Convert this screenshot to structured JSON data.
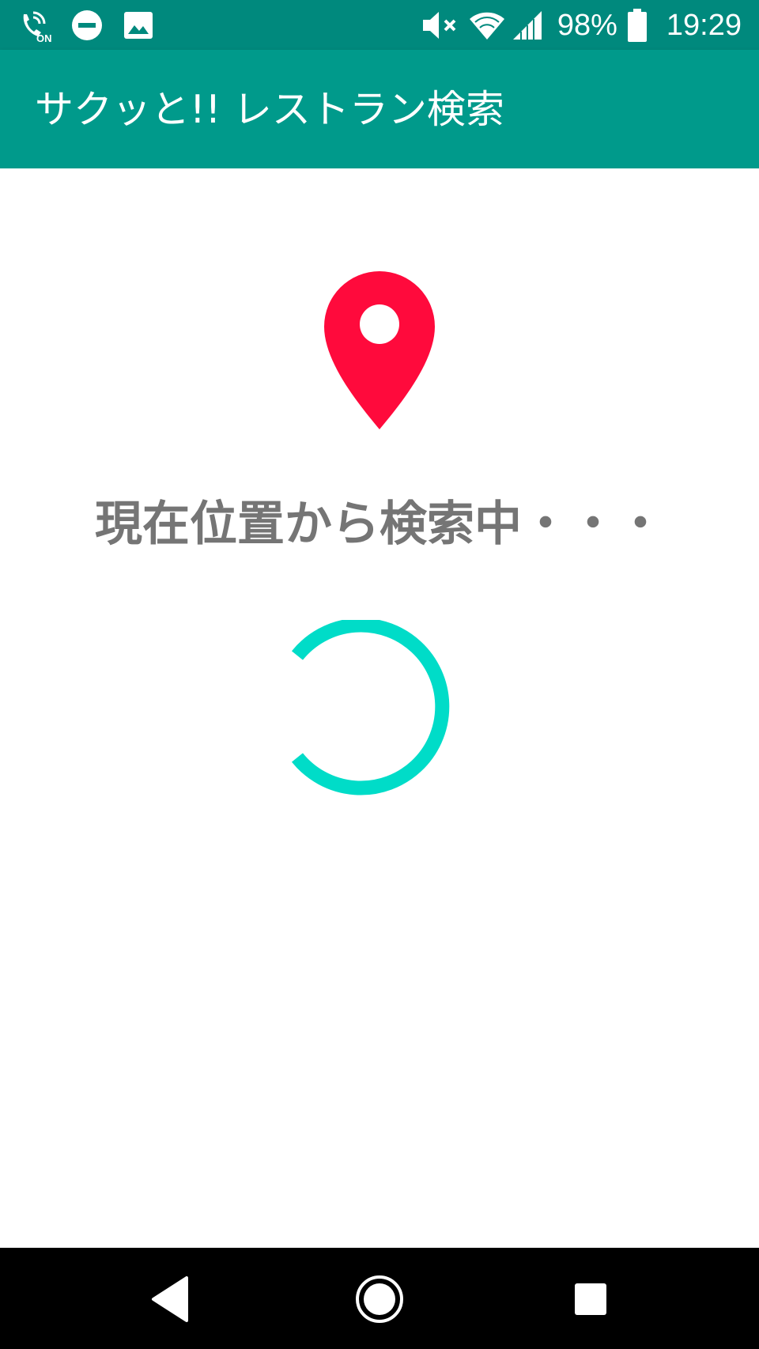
{
  "status_bar": {
    "left_icons": [
      "wifi-calling-on-icon",
      "do-not-disturb-icon",
      "image-icon"
    ],
    "right_icons": [
      "volume-muted-icon",
      "wifi-icon",
      "cell-signal-icon",
      "battery-icon"
    ],
    "battery": "98%",
    "time": "19:29"
  },
  "app_bar": {
    "title": "サクッと!! レストラン検索"
  },
  "main": {
    "status_text": "現在位置から検索中・・・",
    "location_icon": "location-pin-icon",
    "loading_icon": "loading-spinner-icon"
  },
  "nav_bar": {
    "buttons": [
      "back-button",
      "home-button",
      "recents-button"
    ]
  },
  "colors": {
    "status_bar": "#00897d",
    "app_bar": "#009a8b",
    "pin": "#ff0a3c",
    "spinner": "#00dcc8",
    "status_text": "#757575",
    "nav_bar": "#000000"
  }
}
